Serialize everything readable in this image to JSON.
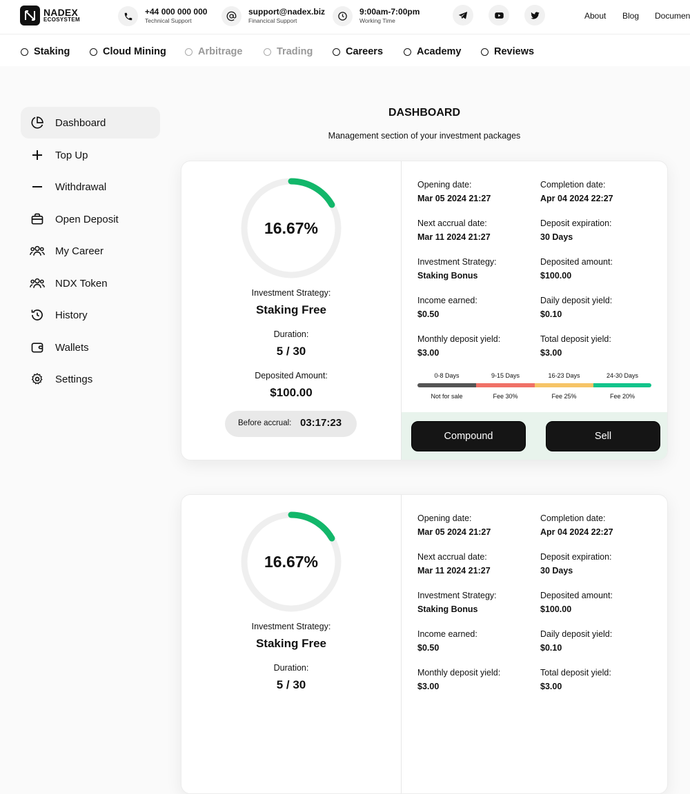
{
  "brand": {
    "name": "NADEX",
    "sub": "ECOSYSTEM"
  },
  "contacts": [
    {
      "icon": "phone-icon",
      "main": "+44 000 000 000",
      "sub": "Technical Support"
    },
    {
      "icon": "at-icon",
      "main": "support@nadex.biz",
      "sub": "Financical Support"
    },
    {
      "icon": "clock-icon",
      "main": "9:00am-7:00pm",
      "sub": "Working Time"
    }
  ],
  "social": [
    "telegram-icon",
    "youtube-icon",
    "twitter-icon"
  ],
  "toplinks": [
    "About",
    "Blog",
    "Document"
  ],
  "nav": [
    {
      "label": "Staking",
      "enabled": true
    },
    {
      "label": "Cloud Mining",
      "enabled": true
    },
    {
      "label": "Arbitrage",
      "enabled": false
    },
    {
      "label": "Trading",
      "enabled": false
    },
    {
      "label": "Careers",
      "enabled": true
    },
    {
      "label": "Academy",
      "enabled": true
    },
    {
      "label": "Reviews",
      "enabled": true
    }
  ],
  "sidebar": {
    "items": [
      {
        "label": "Dashboard",
        "icon": "pie-chart-icon",
        "active": true
      },
      {
        "label": "Top Up",
        "icon": "plus-icon"
      },
      {
        "label": "Withdrawal",
        "icon": "minus-icon"
      },
      {
        "label": "Open Deposit",
        "icon": "briefcase-icon"
      },
      {
        "label": "My Career",
        "icon": "users-icon"
      },
      {
        "label": "NDX Token",
        "icon": "users-icon"
      },
      {
        "label": "History",
        "icon": "history-icon"
      },
      {
        "label": "Wallets",
        "icon": "wallet-icon"
      },
      {
        "label": "Settings",
        "icon": "gear-icon"
      }
    ]
  },
  "main": {
    "title": "DASHBOARD",
    "subtitle": "Management section of your investment packages"
  },
  "colors": {
    "accent": "#12b76a",
    "fee_gray": "#555555",
    "fee_red": "#f07167",
    "fee_orange": "#f6c467",
    "fee_green": "#12c48b",
    "actions_bg": "#e8f3ec"
  },
  "deposits": [
    {
      "progress_text": "16.67%",
      "progress": 0.1667,
      "strategy_label": "Investment Strategy:",
      "strategy": "Staking Free",
      "duration_label": "Duration:",
      "duration": "5 / 30",
      "deposited_label": "Deposited Amount:",
      "deposited": "$100.00",
      "accrual_label": "Before accrual:",
      "accrual_time": "03:17:23",
      "fields": [
        {
          "label": "Opening date:",
          "value": "Mar 05 2024 21:27"
        },
        {
          "label": "Completion date:",
          "value": "Apr 04 2024 22:27"
        },
        {
          "label": "Next accrual date:",
          "value": "Mar 11 2024 21:27"
        },
        {
          "label": "Deposit expiration:",
          "value": "30 Days"
        },
        {
          "label": "Investment Strategy:",
          "value": "Staking Bonus"
        },
        {
          "label": "Deposited amount:",
          "value": "$100.00"
        },
        {
          "label": "Income earned:",
          "value": "$0.50"
        },
        {
          "label": "Daily deposit yield:",
          "value": "$0.10"
        },
        {
          "label": "Monthly deposit yield:",
          "value": "$3.00"
        },
        {
          "label": "Total deposit yield:",
          "value": "$3.00"
        }
      ],
      "fees": [
        {
          "range": "0-8 Days",
          "fee": "Not for sale"
        },
        {
          "range": "9-15 Days",
          "fee": "Fee 30%"
        },
        {
          "range": "16-23 Days",
          "fee": "Fee 25%"
        },
        {
          "range": "24-30 Days",
          "fee": "Fee 20%"
        }
      ],
      "compound_label": "Compound",
      "sell_label": "Sell"
    },
    {
      "progress_text": "16.67%",
      "progress": 0.1667,
      "strategy_label": "Investment Strategy:",
      "strategy": "Staking Free",
      "duration_label": "Duration:",
      "duration": "5 / 30",
      "fields": [
        {
          "label": "Opening date:",
          "value": "Mar 05 2024 21:27"
        },
        {
          "label": "Completion date:",
          "value": "Apr 04 2024 22:27"
        },
        {
          "label": "Next accrual date:",
          "value": "Mar 11 2024 21:27"
        },
        {
          "label": "Deposit expiration:",
          "value": "30 Days"
        },
        {
          "label": "Investment Strategy:",
          "value": "Staking Bonus"
        },
        {
          "label": "Deposited amount:",
          "value": "$100.00"
        },
        {
          "label": "Income earned:",
          "value": "$0.50"
        },
        {
          "label": "Daily deposit yield:",
          "value": "$0.10"
        },
        {
          "label": "Monthly deposit yield:",
          "value": "$3.00"
        },
        {
          "label": "Total deposit yield:",
          "value": "$3.00"
        }
      ]
    }
  ]
}
